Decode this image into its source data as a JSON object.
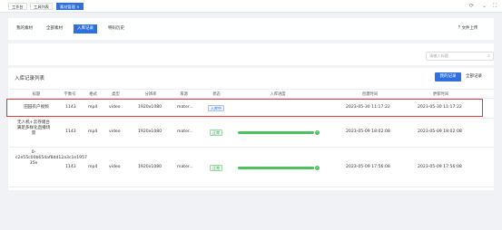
{
  "topbar": {
    "tabs": [
      {
        "label": "工作台"
      },
      {
        "label": "工具列表"
      },
      {
        "label": "素材管理 ×"
      }
    ]
  },
  "filter_tabs": [
    {
      "label": "我的素材"
    },
    {
      "label": "全部素材"
    },
    {
      "label": "入库记录"
    },
    {
      "label": "特码历史"
    }
  ],
  "upload_label": "文件上传",
  "search_placeholder": "请输入标题",
  "section_title": "入库记录列表",
  "buttons": {
    "mine": "我的记录",
    "all": "全部记录"
  },
  "columns": [
    "标题",
    "字数号",
    "格式",
    "类型",
    "分辨率",
    "来源",
    "状态",
    "入库进度",
    "创建时间",
    "更新时间"
  ],
  "rows": [
    {
      "title": "田园农户视频",
      "code": "1143",
      "format": "mp4",
      "type": "video",
      "resolution": "1920x1080",
      "source": "mater...",
      "status": "入库中",
      "progress": 0,
      "created": "2023-05-30 11:17:22",
      "updated": "2023-05-30 11:17:22"
    },
    {
      "title": "无人机+云存储台满足多样化直播场景",
      "code": "1143",
      "format": "mp4",
      "type": "video",
      "resolution": "1920x1080",
      "source": "mater...",
      "status": "正常",
      "progress": 1,
      "created": "2023-05-09 18:02:08",
      "updated": "2023-05-09 18:02:08"
    },
    {
      "title": "0-c2e55c00b654af8dd12a3c1e1957 35e",
      "code": "1143",
      "format": "mp4",
      "type": "video",
      "resolution": "1920x1080",
      "source": "mater...",
      "status": "正常",
      "progress": 1,
      "created": "2023-05-09 17:56:08",
      "updated": "2023-05-09 17:56:08"
    }
  ],
  "colors": {
    "accent": "#2f6fdf",
    "success": "#4cc15d",
    "highlight_border": "#e53935"
  },
  "icons": [
    "upload-icon",
    "search-icon",
    "refresh-icon",
    "expand-icon",
    "check-icon"
  ]
}
